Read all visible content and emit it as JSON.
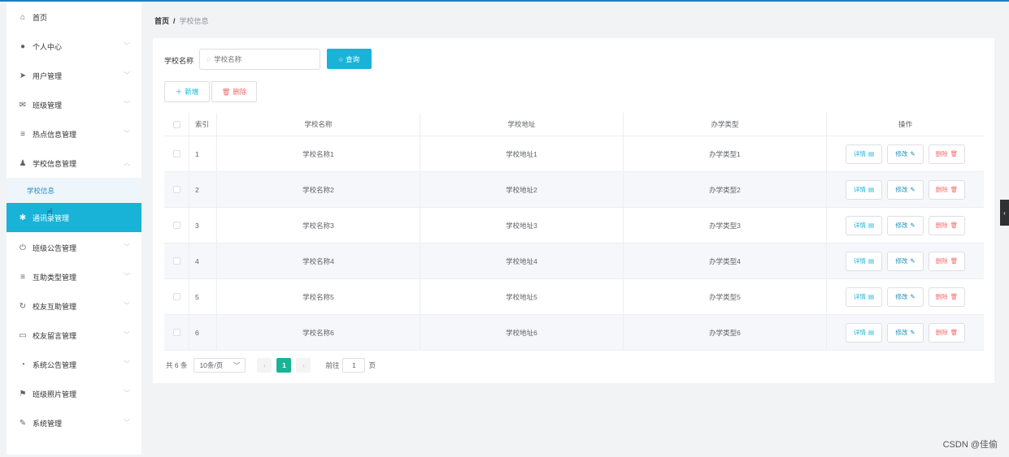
{
  "sidebar": {
    "items": [
      {
        "label": "首页",
        "icon": "home-icon",
        "glyph": "⌂"
      },
      {
        "label": "个人中心",
        "icon": "user-icon",
        "glyph": "●"
      },
      {
        "label": "用户管理",
        "icon": "send-icon",
        "glyph": "➤"
      },
      {
        "label": "班级管理",
        "icon": "mail-icon",
        "glyph": "✉"
      },
      {
        "label": "热点信息管理",
        "icon": "list-icon",
        "glyph": "≡"
      },
      {
        "label": "学校信息管理",
        "icon": "person-icon",
        "glyph": "♟"
      },
      {
        "label": "学校信息",
        "icon": "",
        "glyph": ""
      },
      {
        "label": "通讯录管理",
        "icon": "gear-icon",
        "glyph": "✱"
      },
      {
        "label": "班级公告管理",
        "icon": "power-icon",
        "glyph": "⏻"
      },
      {
        "label": "互助类型管理",
        "icon": "list-icon",
        "glyph": "≡"
      },
      {
        "label": "校友互助管理",
        "icon": "refresh-icon",
        "glyph": "↻"
      },
      {
        "label": "校友留言管理",
        "icon": "chat-icon",
        "glyph": "▭"
      },
      {
        "label": "系统公告管理",
        "icon": "clock-icon",
        "glyph": "◔"
      },
      {
        "label": "班级照片管理",
        "icon": "flag-icon",
        "glyph": "⚑"
      },
      {
        "label": "系统管理",
        "icon": "brush-icon",
        "glyph": "✎"
      }
    ]
  },
  "breadcrumb": {
    "home": "首页",
    "separator": "/",
    "current": "学校信息"
  },
  "filter": {
    "label": "学校名称",
    "placeholder": "学校名称",
    "query_label": "查询"
  },
  "actions": {
    "add_label": "新增",
    "delete_label": "删除"
  },
  "table": {
    "headers": {
      "index": "索引",
      "name": "学校名称",
      "address": "学校地址",
      "type": "办学类型",
      "ops": "操作"
    },
    "rows": [
      {
        "index": "1",
        "name": "学校名称1",
        "address": "学校地址1",
        "type": "办学类型1"
      },
      {
        "index": "2",
        "name": "学校名称2",
        "address": "学校地址2",
        "type": "办学类型2"
      },
      {
        "index": "3",
        "name": "学校名称3",
        "address": "学校地址3",
        "type": "办学类型3"
      },
      {
        "index": "4",
        "name": "学校名称4",
        "address": "学校地址4",
        "type": "办学类型4"
      },
      {
        "index": "5",
        "name": "学校名称5",
        "address": "学校地址5",
        "type": "办学类型5"
      },
      {
        "index": "6",
        "name": "学校名称6",
        "address": "学校地址6",
        "type": "办学类型6"
      }
    ],
    "ops": {
      "detail": "详情",
      "edit": "修改",
      "remove": "删除"
    }
  },
  "pagination": {
    "total": "共 6 条",
    "page_size": "10条/页",
    "current_page": "1",
    "goto_label": "前往",
    "goto_value": "1",
    "page_suffix": "页"
  },
  "watermark": "CSDN @佳偷",
  "colors": {
    "accent": "#1ab3d8",
    "danger": "#f56c6c",
    "page_active": "#1ab395"
  }
}
